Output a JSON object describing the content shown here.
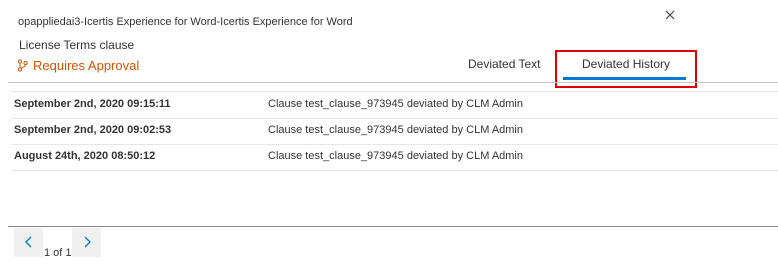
{
  "window": {
    "title": "opappliedai3-Icertis Experience for Word-Icertis Experience for Word"
  },
  "clause": {
    "name": "License Terms clause",
    "status_label": "Requires Approval"
  },
  "tabs": [
    {
      "label": "Deviated Text",
      "selected": false
    },
    {
      "label": "Deviated History",
      "selected": true
    }
  ],
  "history": [
    {
      "date": "September 2nd, 2020 09:15:11",
      "description": "Clause test_clause_973945 deviated by CLM Admin"
    },
    {
      "date": "September 2nd, 2020 09:02:53",
      "description": "Clause test_clause_973945 deviated by CLM Admin"
    },
    {
      "date": "August 24th, 2020 08:50:12",
      "description": "Clause test_clause_973945 deviated by CLM Admin"
    }
  ],
  "pagination": {
    "info": "1 of 1"
  },
  "icons": {
    "close": "close-icon",
    "status": "branch-icon",
    "prev": "chevron-left-icon",
    "next": "chevron-right-icon"
  },
  "colors": {
    "accent": "#0078d4",
    "status": "#d35400",
    "highlight": "#e00000"
  }
}
